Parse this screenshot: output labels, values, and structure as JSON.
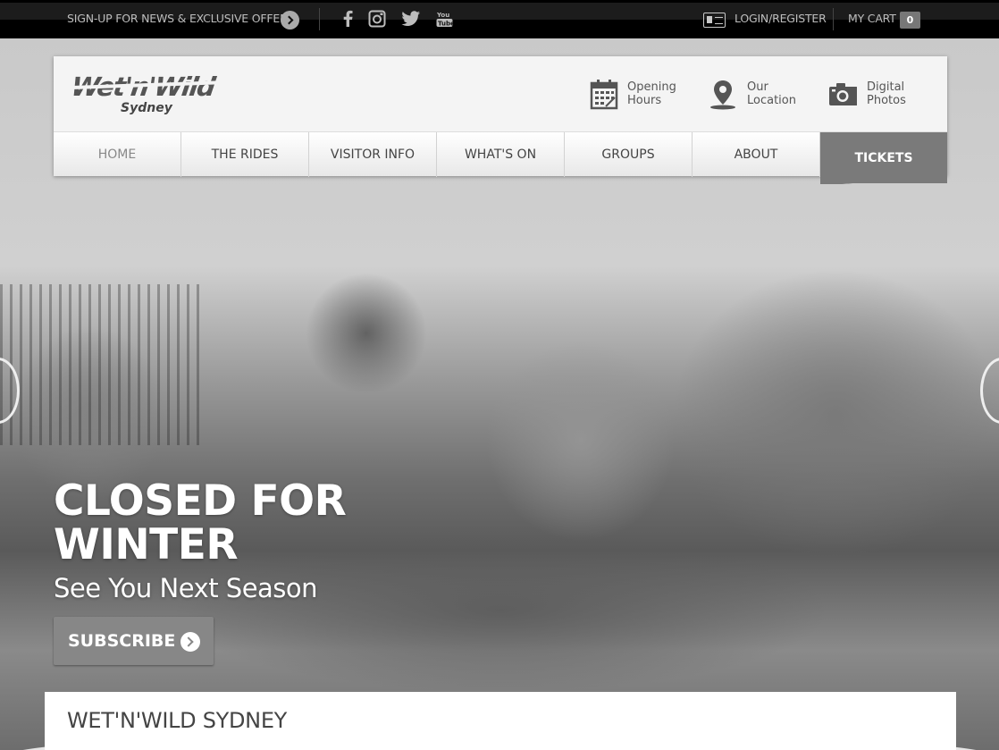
{
  "topbar": {
    "signup_text": "SIGN-UP FOR NEWS & EXCLUSIVE OFFERS",
    "social": [
      "facebook-icon",
      "instagram-icon",
      "twitter-icon",
      "youtube-icon"
    ],
    "login_text": "LOGIN/REGISTER",
    "cart_text": "MY CART",
    "cart_count": "0"
  },
  "header": {
    "logo_main": "Wet'n'Wild",
    "logo_sub": "Sydney",
    "links": [
      {
        "line1": "Opening",
        "line2": "Hours",
        "icon": "calendar-icon"
      },
      {
        "line1": "Our",
        "line2": "Location",
        "icon": "location-pin-icon"
      },
      {
        "line1": "Digital",
        "line2": "Photos",
        "icon": "camera-icon"
      }
    ]
  },
  "nav": {
    "tabs": [
      "HOME",
      "THE RIDES",
      "VISITOR INFO",
      "WHAT'S ON",
      "GROUPS",
      "ABOUT",
      "TICKETS"
    ]
  },
  "hero": {
    "headline_line1": "CLOSED FOR",
    "headline_line2": "WINTER",
    "subline": "See You Next Season",
    "cta": "SUBSCRIBE"
  },
  "content": {
    "title": "WET'N'WILD SYDNEY"
  },
  "colors": {
    "topbar": "#000000",
    "tickets_tab": "#7a7a7a",
    "subscribe_button": "#878787"
  }
}
